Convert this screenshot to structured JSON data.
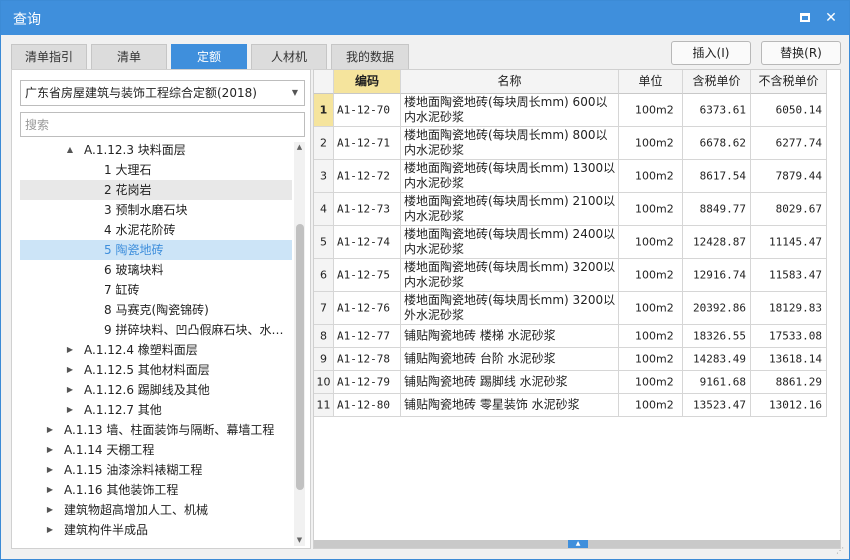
{
  "window": {
    "title": "查询"
  },
  "tabs": [
    "清单指引",
    "清单",
    "定额",
    "人材机",
    "我的数据"
  ],
  "actions": {
    "insert": "插入(I)",
    "replace": "替换(R)"
  },
  "library_select": "广东省房屋建筑与装饰工程综合定额(2018)",
  "search_placeholder": "搜索",
  "tree": [
    {
      "label": "A.1.12.3 块料面层",
      "expand": "▲"
    },
    {
      "label": "1 大理石",
      "expand": ""
    },
    {
      "label": "2 花岗岩",
      "expand": ""
    },
    {
      "label": "3 预制水磨石块",
      "expand": ""
    },
    {
      "label": "4 水泥花阶砖",
      "expand": ""
    },
    {
      "label": "5 陶瓷地砖",
      "expand": ""
    },
    {
      "label": "6 玻璃块料",
      "expand": ""
    },
    {
      "label": "7 缸砖",
      "expand": ""
    },
    {
      "label": "8 马赛克(陶瓷锦砖)",
      "expand": ""
    },
    {
      "label": "9 拼碎块料、凹凸假麻石块、水…",
      "expand": ""
    },
    {
      "label": "A.1.12.4 橡塑料面层",
      "expand": "▶"
    },
    {
      "label": "A.1.12.5 其他材料面层",
      "expand": "▶"
    },
    {
      "label": "A.1.12.6 踢脚线及其他",
      "expand": "▶"
    },
    {
      "label": "A.1.12.7 其他",
      "expand": "▶"
    },
    {
      "label": "A.1.13 墙、柱面装饰与隔断、幕墙工程",
      "expand": "▶"
    },
    {
      "label": "A.1.14 天棚工程",
      "expand": "▶"
    },
    {
      "label": "A.1.15 油漆涂料裱糊工程",
      "expand": "▶"
    },
    {
      "label": "A.1.16 其他装饰工程",
      "expand": "▶"
    },
    {
      "label": "建筑物超高增加人工、机械",
      "expand": "▶"
    },
    {
      "label": "建筑构件半成品",
      "expand": "▶"
    }
  ],
  "grid": {
    "headers": [
      "",
      "编码",
      "名称",
      "单位",
      "含税单价",
      "不含税单价"
    ],
    "rows": [
      {
        "idx": "1",
        "code": "A1-12-70",
        "name": "楼地面陶瓷地砖(每块周长mm) 600以内水泥砂浆",
        "unit": "100m2",
        "tax_price": "6373.61",
        "notax_price": "6050.14"
      },
      {
        "idx": "2",
        "code": "A1-12-71",
        "name": "楼地面陶瓷地砖(每块周长mm) 800以内水泥砂浆",
        "unit": "100m2",
        "tax_price": "6678.62",
        "notax_price": "6277.74"
      },
      {
        "idx": "3",
        "code": "A1-12-72",
        "name": "楼地面陶瓷地砖(每块周长mm) 1300以内水泥砂浆",
        "unit": "100m2",
        "tax_price": "8617.54",
        "notax_price": "7879.44"
      },
      {
        "idx": "4",
        "code": "A1-12-73",
        "name": "楼地面陶瓷地砖(每块周长mm) 2100以内水泥砂浆",
        "unit": "100m2",
        "tax_price": "8849.77",
        "notax_price": "8029.67"
      },
      {
        "idx": "5",
        "code": "A1-12-74",
        "name": "楼地面陶瓷地砖(每块周长mm) 2400以内水泥砂浆",
        "unit": "100m2",
        "tax_price": "12428.87",
        "notax_price": "11145.47"
      },
      {
        "idx": "6",
        "code": "A1-12-75",
        "name": "楼地面陶瓷地砖(每块周长mm) 3200以内水泥砂浆",
        "unit": "100m2",
        "tax_price": "12916.74",
        "notax_price": "11583.47"
      },
      {
        "idx": "7",
        "code": "A1-12-76",
        "name": "楼地面陶瓷地砖(每块周长mm) 3200以外水泥砂浆",
        "unit": "100m2",
        "tax_price": "20392.86",
        "notax_price": "18129.83"
      },
      {
        "idx": "8",
        "code": "A1-12-77",
        "name": "铺贴陶瓷地砖 楼梯 水泥砂浆",
        "unit": "100m2",
        "tax_price": "18326.55",
        "notax_price": "17533.08"
      },
      {
        "idx": "9",
        "code": "A1-12-78",
        "name": "铺贴陶瓷地砖 台阶 水泥砂浆",
        "unit": "100m2",
        "tax_price": "14283.49",
        "notax_price": "13618.14"
      },
      {
        "idx": "10",
        "code": "A1-12-79",
        "name": "铺贴陶瓷地砖 踢脚线 水泥砂浆",
        "unit": "100m2",
        "tax_price": "9161.68",
        "notax_price": "8861.29"
      },
      {
        "idx": "11",
        "code": "A1-12-80",
        "name": "铺贴陶瓷地砖 零星装饰 水泥砂浆",
        "unit": "100m2",
        "tax_price": "13523.47",
        "notax_price": "13012.16"
      }
    ]
  },
  "colors": {
    "accent": "#3f8fdc",
    "header_highlight": "#f5e49d",
    "tree_selected_bg": "#cce4f7"
  }
}
